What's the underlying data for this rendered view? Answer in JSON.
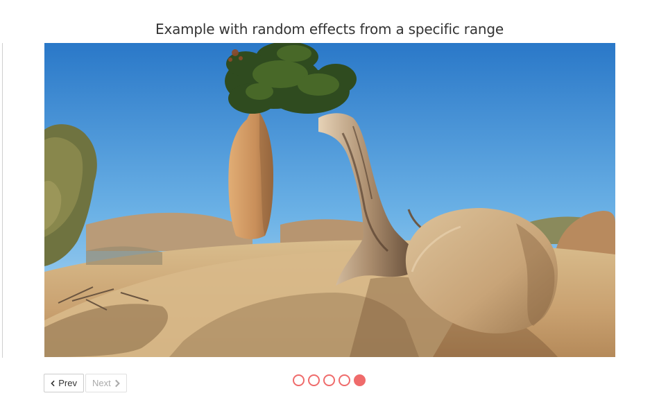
{
  "slider": {
    "title": "Example with random effects from a specific range",
    "slide_image": "desert-juniper-tree-and-boulders",
    "prev_label": "Prev",
    "next_label": "Next",
    "pager": {
      "total": 5,
      "active_index": 5
    },
    "colors": {
      "accent": "#ef6b6b",
      "sky_top": "#2f7fcf",
      "sand": "#d7b685"
    }
  }
}
